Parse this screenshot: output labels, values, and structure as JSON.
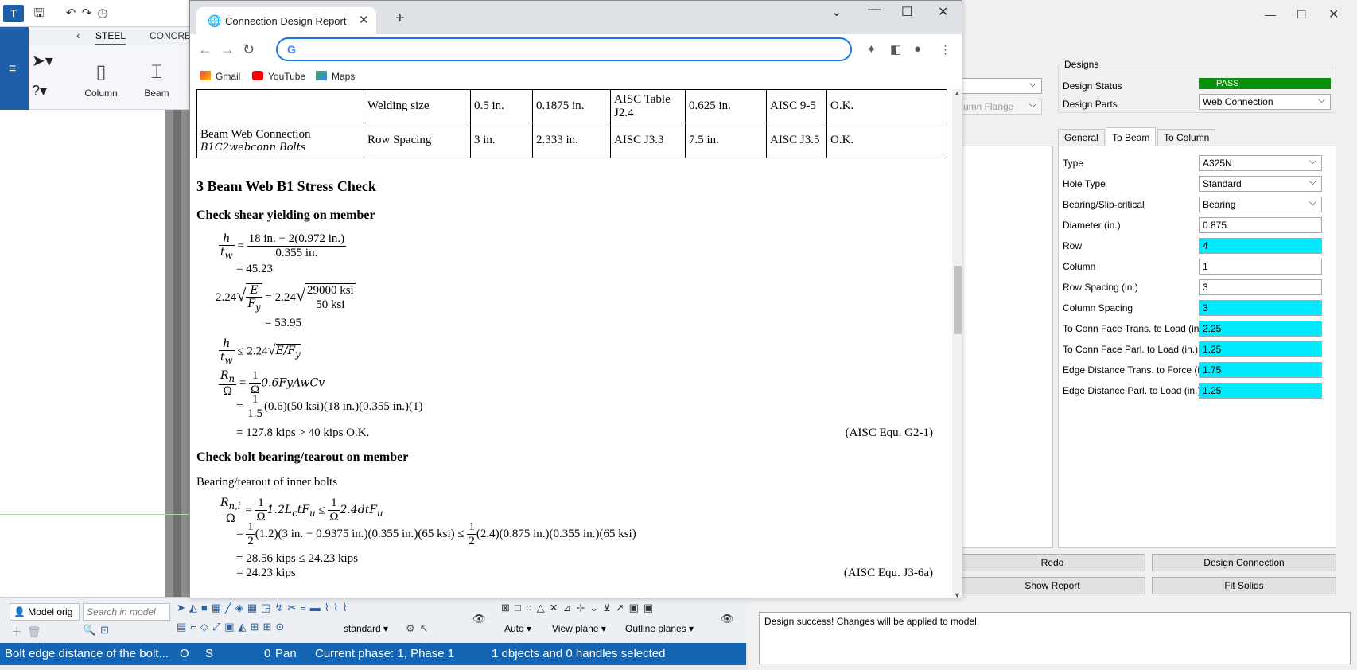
{
  "tekla": {
    "ribbon_tabs": [
      "STEEL",
      "CONCRETE"
    ],
    "ribbon_buttons": [
      "Column",
      "Beam"
    ],
    "model_origin": "Model orig",
    "search_placeholder": "Search in model",
    "view_standard": "standard",
    "auto_label": "Auto",
    "view_plane": "View plane",
    "outline_planes": "Outline planes",
    "status": {
      "message": "Bolt edge distance of the bolt...",
      "o": "O",
      "s": "S",
      "zero": "0",
      "pan": "Pan",
      "phase": "Current phase: 1, Phase 1",
      "selection": "1 objects and 0 handles selected"
    }
  },
  "browser": {
    "tab_title": "Connection Design Report",
    "bookmarks": [
      "Gmail",
      "YouTube",
      "Maps"
    ],
    "report": {
      "table_rows": [
        {
          "part": "",
          "check": "Welding size",
          "provided": "0.5 in.",
          "required_min": "0.1875 in.",
          "ref_min": "AISC Table J2.4",
          "limit_max": "0.625 in.",
          "ref_max": "AISC 9-5",
          "result": "O.K."
        },
        {
          "part_line1": "Beam Web Connection",
          "part_line2": "B1C2webconn Bolts",
          "check": "Row Spacing",
          "provided": "3 in.",
          "required_min": "2.333 in.",
          "ref_min": "AISC J3.3",
          "limit_max": "7.5 in.",
          "ref_max": "AISC J3.5",
          "result": "O.K."
        }
      ],
      "section_title": "3 Beam Web B1 Stress Check",
      "shear_heading": "Check shear yielding on member",
      "eq1_num": "18 in. − 2(0.972 in.)",
      "eq1_den": "0.355 in.",
      "eq1_result": "= 45.23",
      "eq2_inner_num": "29000 ksi",
      "eq2_inner_den": "50 ksi",
      "eq2_result": "= 53.95",
      "eq4_rhs": "0.6FyAwCv",
      "eq4_sub": "(0.6)(50 ksi)(18 in.)(0.355 in.)(1)",
      "eq4_omega": "1.5",
      "eq4_result": "= 127.8 kips > 40 kips  O.K.",
      "eq4_ref": "(AISC Equ. G2-1)",
      "bearing_heading": "Check bolt bearing/tearout on member",
      "bearing_sub": "Bearing/tearout of inner bolts",
      "eq5_sub_left": "(1.2)(3 in. − 0.9375 in.)(0.355 in.)(65 ksi) ≤",
      "eq5_sub_right": "(2.4)(0.875 in.)(0.355 in.)(65 ksi)",
      "eq5_line2": "= 28.56 kips ≤ 24.23 kips",
      "eq5_line3": "= 24.23 kips",
      "eq5_ref": "(AISC Equ. J3-6a)"
    }
  },
  "dialog": {
    "designs_label": "Designs",
    "design_status_label": "Design Status",
    "design_status_value": "PASS",
    "design_parts_label": "Design Parts",
    "design_parts_value": "Web Connection",
    "left_combo_2": "umn Flange",
    "tabs": [
      "General",
      "To Beam",
      "To Column"
    ],
    "properties": [
      {
        "label": "Type",
        "value": "A325N",
        "kind": "combo",
        "highlight": false
      },
      {
        "label": "Hole Type",
        "value": "Standard",
        "kind": "combo",
        "highlight": false
      },
      {
        "label": "Bearing/Slip-critical",
        "value": "Bearing",
        "kind": "combo",
        "highlight": false
      },
      {
        "label": "Diameter (in.)",
        "value": "0.875",
        "kind": "field",
        "highlight": false
      },
      {
        "label": "Row",
        "value": "4",
        "kind": "field",
        "highlight": true
      },
      {
        "label": "Column",
        "value": "1",
        "kind": "field",
        "highlight": false
      },
      {
        "label": "Row Spacing (in.)",
        "value": "3",
        "kind": "field",
        "highlight": false
      },
      {
        "label": "Column Spacing",
        "value": "3",
        "kind": "field",
        "highlight": true
      },
      {
        "label": "To Conn Face Trans. to Load (in.)",
        "value": "2.25",
        "kind": "field",
        "highlight": true
      },
      {
        "label": "To Conn Face Parl. to Load (in.)",
        "value": "1.25",
        "kind": "field",
        "highlight": true
      },
      {
        "label": "Edge Distance Trans. to Force (in.)",
        "value": "1.75",
        "kind": "field",
        "highlight": true
      },
      {
        "label": "Edge Distance Parl. to Load (in.)",
        "value": "1.25",
        "kind": "field",
        "highlight": true
      }
    ],
    "buttons": {
      "redo": "Redo",
      "design_connection": "Design Connection",
      "show_report": "Show Report",
      "fit_solids": "Fit Solids"
    },
    "log_message": "Design success! Changes will be applied to model."
  },
  "colors": {
    "tekla_blue": "#1466b4",
    "pass_green": "#0a8f0a",
    "highlight_cyan": "#00eaff",
    "omnibox_focus": "#1a73e8"
  }
}
